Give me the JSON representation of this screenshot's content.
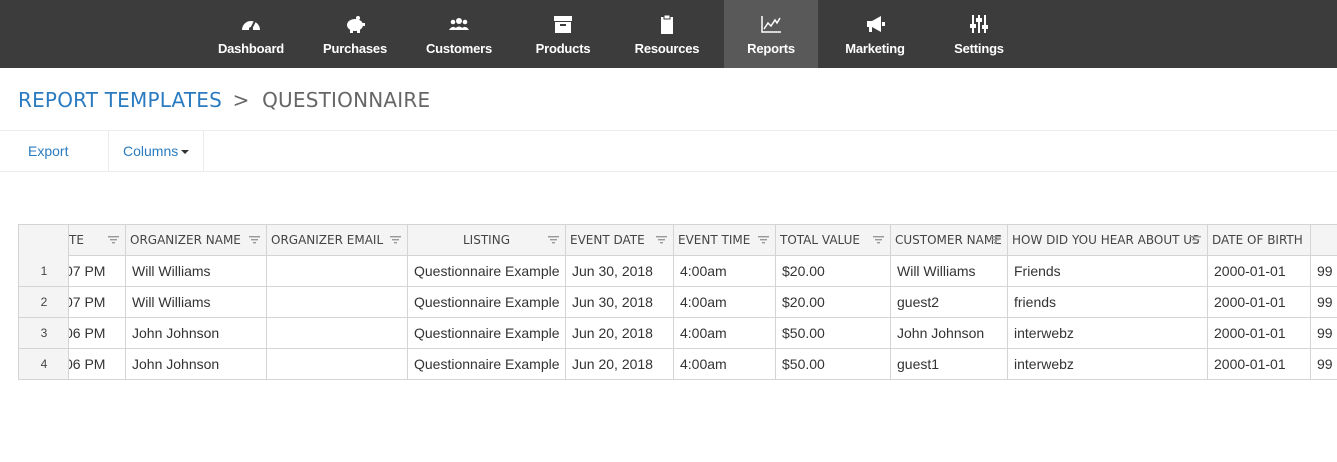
{
  "nav": {
    "items": [
      {
        "label": "Dashboard",
        "icon": "dashboard-icon"
      },
      {
        "label": "Purchases",
        "icon": "piggy-bank-icon"
      },
      {
        "label": "Customers",
        "icon": "users-icon"
      },
      {
        "label": "Products",
        "icon": "archive-box-icon"
      },
      {
        "label": "Resources",
        "icon": "clipboard-icon"
      },
      {
        "label": "Reports",
        "icon": "line-chart-icon"
      },
      {
        "label": "Marketing",
        "icon": "megaphone-icon"
      },
      {
        "label": "Settings",
        "icon": "sliders-icon"
      }
    ],
    "active": "Reports"
  },
  "breadcrumb": {
    "parent": "REPORT TEMPLATES",
    "separator": ">",
    "current": "QUESTIONNAIRE"
  },
  "toolbar": {
    "export_label": "Export",
    "columns_label": "Columns"
  },
  "table": {
    "headers": [
      "TE",
      "ORGANIZER NAME",
      "ORGANIZER EMAIL",
      "LISTING",
      "EVENT DATE",
      "EVENT TIME",
      "TOTAL VALUE",
      "CUSTOMER NAME",
      "HOW DID YOU HEAR ABOUT US",
      "DATE OF BIRTH",
      ""
    ],
    "rows": [
      {
        "num": "1",
        "cells": [
          "07 PM",
          "Will Williams",
          "",
          "Questionnaire Example",
          "Jun 30, 2018",
          "4:00am",
          "$20.00",
          "Will Williams",
          "Friends",
          "2000-01-01",
          "99"
        ]
      },
      {
        "num": "2",
        "cells": [
          "07 PM",
          "Will Williams",
          "",
          "Questionnaire Example",
          "Jun 30, 2018",
          "4:00am",
          "$20.00",
          "guest2",
          "friends",
          "2000-01-01",
          "99"
        ]
      },
      {
        "num": "3",
        "cells": [
          "06 PM",
          "John Johnson",
          "",
          "Questionnaire Example",
          "Jun 20, 2018",
          "4:00am",
          "$50.00",
          "John Johnson",
          "interwebz",
          "2000-01-01",
          "99"
        ]
      },
      {
        "num": "4",
        "cells": [
          "06 PM",
          "John Johnson",
          "",
          "Questionnaire Example",
          "Jun 20, 2018",
          "4:00am",
          "$50.00",
          "guest1",
          "interwebz",
          "2000-01-01",
          "99"
        ]
      }
    ]
  }
}
